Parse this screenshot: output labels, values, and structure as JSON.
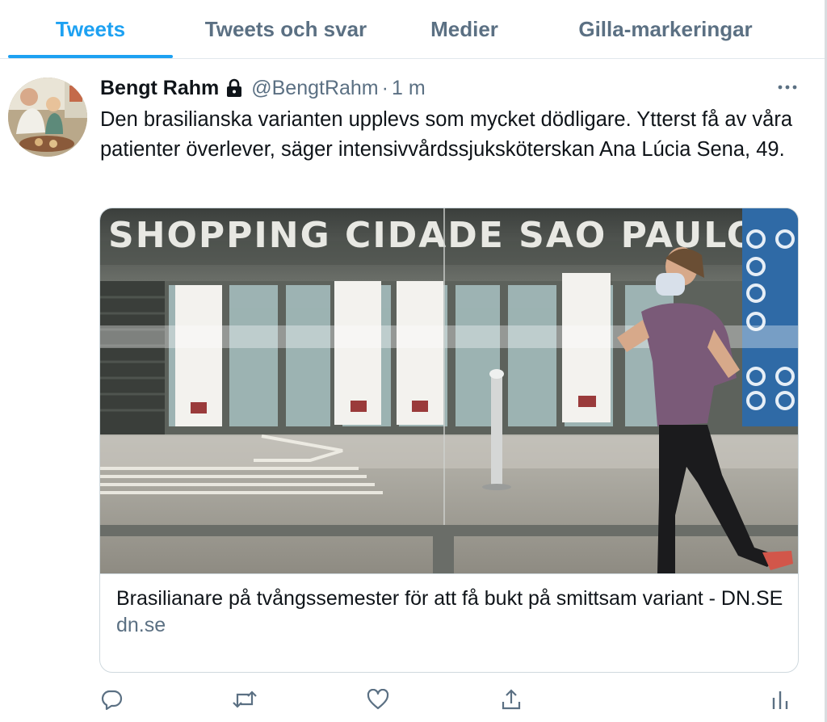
{
  "tabs": [
    {
      "label": "Tweets",
      "active": true
    },
    {
      "label": "Tweets och svar",
      "active": false
    },
    {
      "label": "Medier",
      "active": false
    },
    {
      "label": "Gilla-markeringar",
      "active": false
    }
  ],
  "tweet": {
    "display_name": "Bengt Rahm",
    "handle": "@BengtRahm",
    "separator": "·",
    "time": "1 m",
    "text": "Den brasilianska varianten upplevs som mycket dödligare. Ytterst få av våra patienter överlever, säger intensivvårdssjuksköterskan Ana Lúcia Sena, 49.",
    "card": {
      "image_sign": "SHOPPING CIDADE SAO PAULO",
      "title": "Brasilianare på tvångssemester för att få bukt på smittsam variant - DN.SE",
      "domain": "dn.se"
    }
  },
  "icons": {
    "lock": "lock-icon",
    "more": "more-icon",
    "reply": "reply-icon",
    "retweet": "retweet-icon",
    "like": "heart-icon",
    "share": "share-icon",
    "analytics": "analytics-icon"
  },
  "colors": {
    "accent": "#1da1f2",
    "secondary_text": "#5b7083",
    "primary_text": "#0f1419",
    "border": "#cfd9de"
  }
}
